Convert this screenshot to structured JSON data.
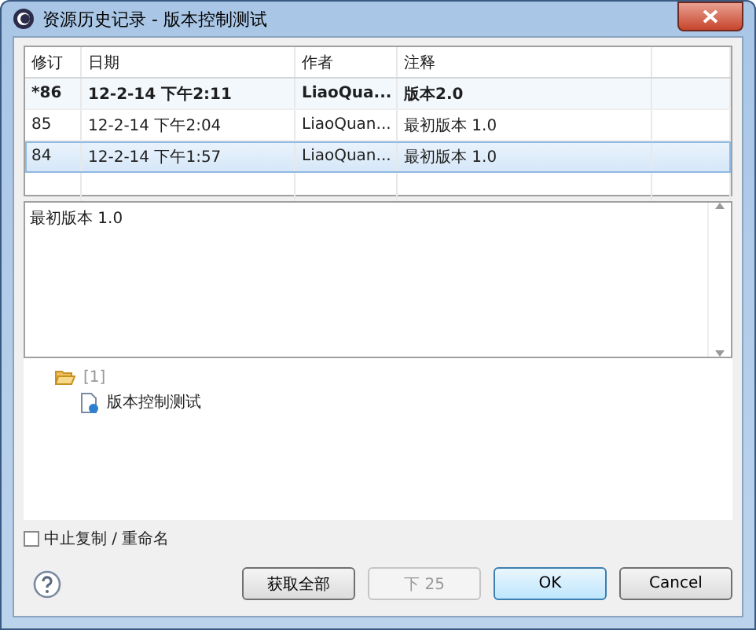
{
  "window": {
    "title": "资源历史记录 - 版本控制测试"
  },
  "table": {
    "columns": [
      "修订",
      "日期",
      "作者",
      "注释"
    ],
    "rows": [
      {
        "revision": "*86",
        "date": "12-2-14 下午2:11",
        "author": "LiaoQua...",
        "comment": "版本2.0",
        "current": true,
        "selected": false
      },
      {
        "revision": "85",
        "date": "12-2-14 下午2:04",
        "author": "LiaoQuan...",
        "comment": "最初版本 1.0",
        "current": false,
        "selected": false
      },
      {
        "revision": "84",
        "date": "12-2-14 下午1:57",
        "author": "LiaoQuan...",
        "comment": "最初版本 1.0",
        "current": false,
        "selected": true
      }
    ]
  },
  "comment_text": "最初版本 1.0",
  "tree": [
    {
      "label": "[1]",
      "kind": "folder",
      "children": [
        {
          "label": "版本控制测试",
          "kind": "file"
        }
      ]
    }
  ],
  "checkbox": {
    "label": "中止复制 / 重命名",
    "checked": false
  },
  "buttons": [
    {
      "label": "获取全部",
      "disabled": false,
      "default": false
    },
    {
      "label": "下 25",
      "disabled": true,
      "default": false
    },
    {
      "label": "OK",
      "disabled": false,
      "default": true
    },
    {
      "label": "Cancel",
      "disabled": false,
      "default": false
    }
  ]
}
